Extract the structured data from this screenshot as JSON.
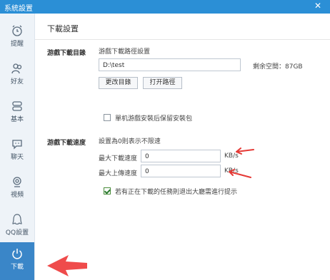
{
  "window": {
    "title": "系統設置",
    "close_glyph": "✕"
  },
  "sidebar": {
    "items": [
      {
        "label": "提醒",
        "icon": "alarm-clock-icon"
      },
      {
        "label": "好友",
        "icon": "friends-icon"
      },
      {
        "label": "基本",
        "icon": "basic-settings-icon"
      },
      {
        "label": "聊天",
        "icon": "chat-bubble-icon"
      },
      {
        "label": "視頻",
        "icon": "video-camera-icon"
      },
      {
        "label": "QQ設置",
        "icon": "qq-penguin-icon"
      },
      {
        "label": "下載",
        "icon": "download-power-icon",
        "active": true
      }
    ]
  },
  "main": {
    "title": "下載設置",
    "download_dir": {
      "section_label": "游戲下載目錄",
      "path_label": "游戲下載路徑設置",
      "path_value": "D:\\test",
      "free_space": "剩余空間：87GB",
      "change_button": "更改目錄",
      "open_button": "打开路徑",
      "keep_package_label": "單机游戲安裝后保留安裝包",
      "keep_package_checked": false
    },
    "download_speed": {
      "section_label": "游戲下載速度",
      "hint": "設置為0則表示不限速",
      "max_download_label": "最大下載速度",
      "max_download_value": "0",
      "max_upload_label": "最大上傳速度",
      "max_upload_value": "0",
      "unit": "KB/s",
      "exit_prompt_label": "若有正在下載的任務則退出大廳需進行提示",
      "exit_prompt_checked": true
    }
  },
  "colors": {
    "title_bar": "#2b8fd6",
    "active_nav": "#3a86c8",
    "annotation_arrow": "#e53935"
  }
}
